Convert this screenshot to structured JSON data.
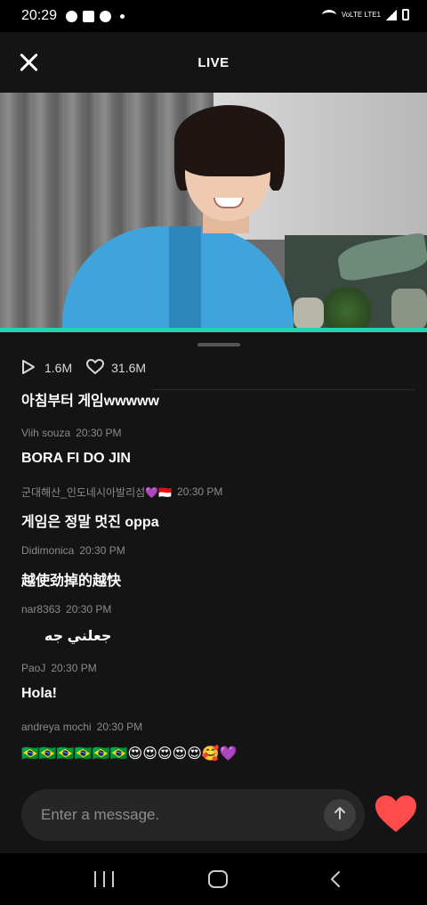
{
  "status_bar": {
    "time": "20:29",
    "icons": [
      "whatsapp-icon",
      "image-icon",
      "b-app-icon",
      "notification-dot",
      "wifi-icon",
      "lte-icon",
      "signal-icon",
      "battery-icon"
    ],
    "lte_text": "VoLTE LTE1"
  },
  "header": {
    "title": "LIVE",
    "close_icon": "close-icon"
  },
  "stats": {
    "plays": "1.6M",
    "likes": "31.6M"
  },
  "chat": {
    "first_message": "아침부터 게임wwwww",
    "messages": [
      {
        "user": "Viih souza",
        "time": "20:30 PM",
        "text": "BORA FI DO JIN"
      },
      {
        "user": "군대해산_인도네시아발리섬💜🇮🇩",
        "time": "20:30 PM",
        "text": "게임은 정말 멋진 oppa"
      },
      {
        "user": "Didimonica",
        "time": "20:30 PM",
        "text": "越使劲掉的越快"
      },
      {
        "user": "nar8363",
        "time": "20:30 PM",
        "text": "جعلني جه"
      },
      {
        "user": "PaoJ",
        "time": "20:30 PM",
        "text": "Hola!"
      },
      {
        "user": "andreya mochi",
        "time": "20:30 PM",
        "text": "🇧🇷🇧🇷🇧🇷🇧🇷🇧🇷🇧🇷😍😍😍😍😍🥰💜"
      }
    ]
  },
  "composer": {
    "placeholder": "Enter a message.",
    "send_icon": "arrow-up-icon",
    "like_icon": "heart-icon"
  },
  "colors": {
    "accent": "#20d4b0",
    "like": "#ff4b4b",
    "panel": "#141414",
    "meta_text": "#8a8a8a"
  },
  "nav_bar": {
    "icons": [
      "recent-apps-icon",
      "home-icon",
      "back-icon"
    ]
  }
}
